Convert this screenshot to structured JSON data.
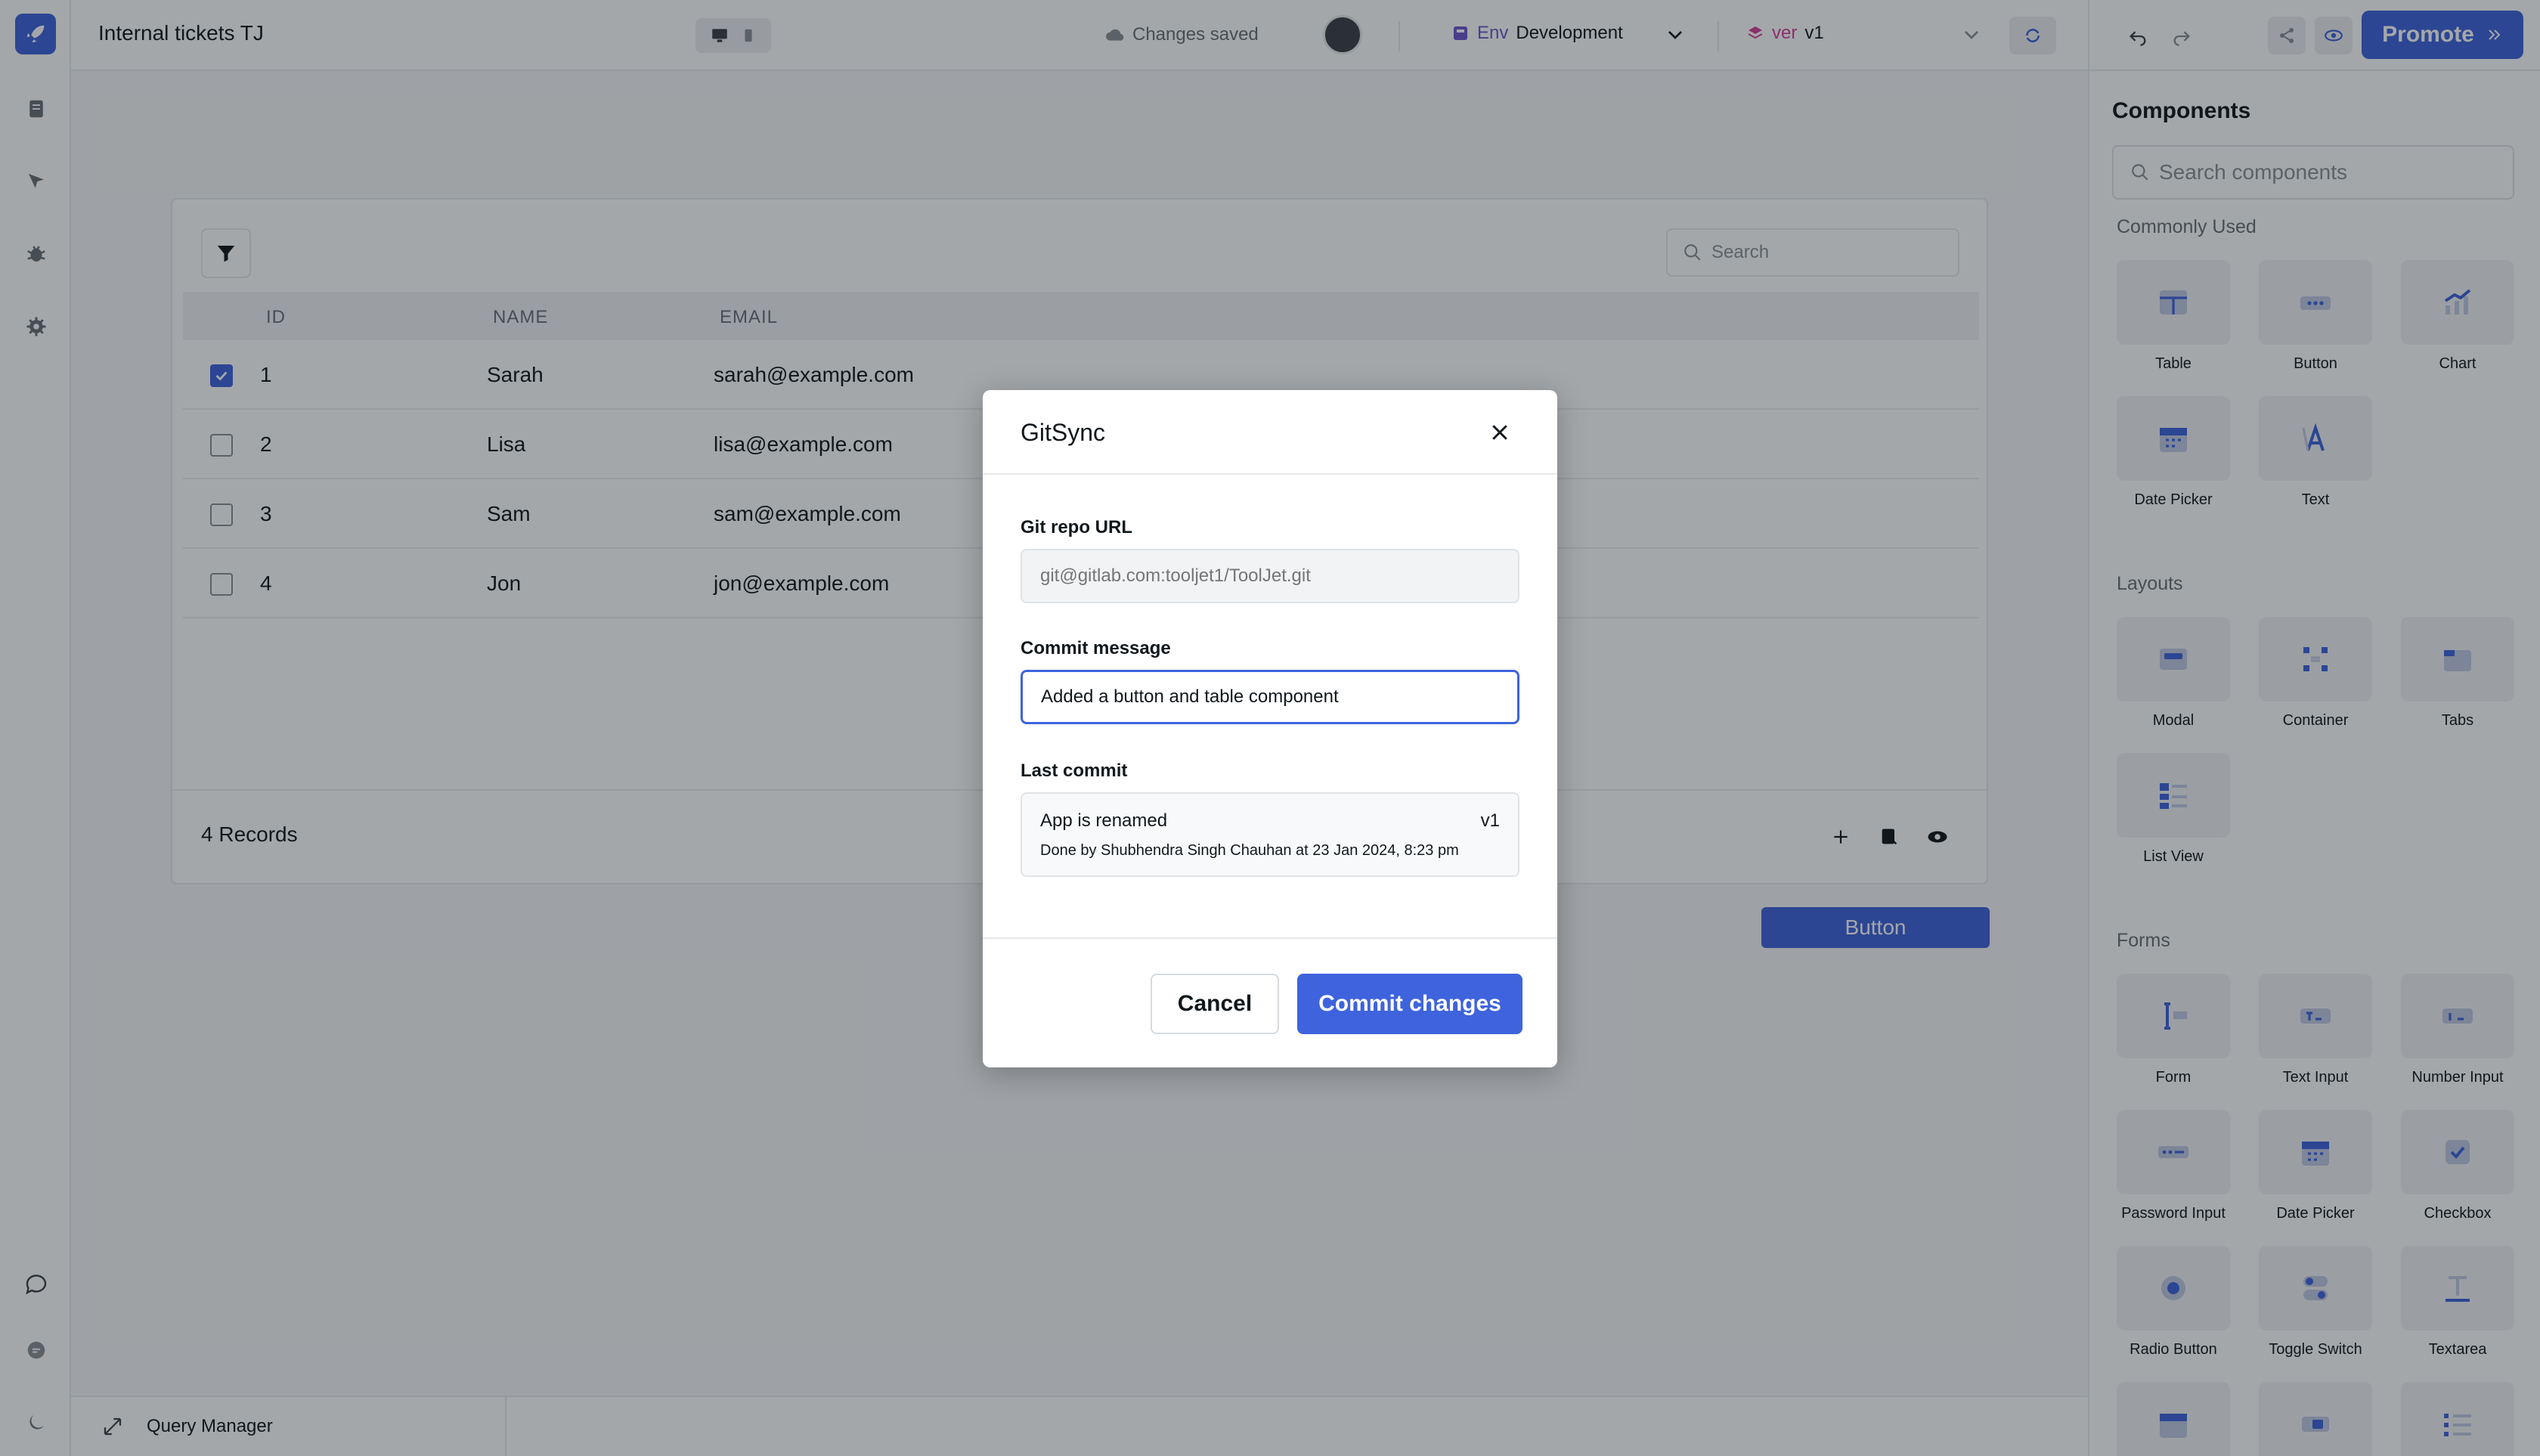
{
  "app": {
    "title": "Internal tickets TJ",
    "save_status": "Changes saved",
    "env_tag": "Env",
    "env_value": "Development",
    "ver_tag": "ver",
    "ver_value": "v1",
    "promote_label": "Promote",
    "accent": "#3e63dd"
  },
  "left_sidebar": {
    "icons": [
      "pages-icon",
      "inspector-icon",
      "debugger-icon",
      "settings-icon",
      "comments-icon",
      "chat-icon",
      "dark-mode-icon"
    ]
  },
  "table": {
    "search_placeholder": "Search",
    "columns": [
      "ID",
      "NAME",
      "EMAIL"
    ],
    "rows": [
      {
        "id": "1",
        "name": "Sarah",
        "email": "sarah@example.com",
        "checked": true
      },
      {
        "id": "2",
        "name": "Lisa",
        "email": "lisa@example.com",
        "checked": false
      },
      {
        "id": "3",
        "name": "Sam",
        "email": "sam@example.com",
        "checked": false
      },
      {
        "id": "4",
        "name": "Jon",
        "email": "jon@example.com",
        "checked": false
      }
    ],
    "records_label": "4 Records"
  },
  "canvas_button": {
    "label": "Button"
  },
  "query_manager": {
    "label": "Query Manager"
  },
  "components_panel": {
    "title": "Components",
    "search_placeholder": "Search components",
    "sections": {
      "commonly_used": {
        "title": "Commonly Used",
        "items": [
          "Table",
          "Button",
          "Chart",
          "Date Picker",
          "Text"
        ]
      },
      "layouts": {
        "title": "Layouts",
        "items": [
          "Modal",
          "Container",
          "Tabs",
          "List View"
        ]
      },
      "forms": {
        "title": "Forms",
        "items": [
          "Form",
          "Text Input",
          "Number Input",
          "Password Input",
          "Date Picker",
          "Checkbox",
          "Radio Button",
          "Toggle Switch",
          "Textarea"
        ]
      }
    }
  },
  "modal": {
    "title": "GitSync",
    "repo_label": "Git repo URL",
    "repo_placeholder": "git@gitlab.com:tooljet1/ToolJet.git",
    "commit_label": "Commit message",
    "commit_value": "Added a button and table component",
    "last_commit_label": "Last commit",
    "last_commit": {
      "message": "App is renamed",
      "version": "v1",
      "meta": "Done by Shubhendra Singh Chauhan at 23 Jan 2024, 8:23 pm"
    },
    "cancel_label": "Cancel",
    "commit_button_label": "Commit changes"
  }
}
